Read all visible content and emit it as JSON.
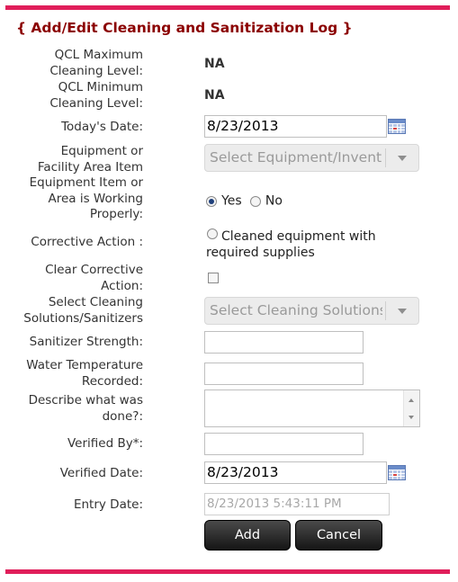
{
  "title": "{ Add/Edit Cleaning and Sanitization Log }",
  "fields": {
    "qcl_max_label": "QCL Maximum\nCleaning Level:",
    "qcl_max_value": "NA",
    "qcl_min_label": "QCL Minimum\nCleaning Level:",
    "qcl_min_value": "NA",
    "todays_date_label": "Today's Date:",
    "todays_date_value": "8/23/2013",
    "equipment_label": "Equipment or\nFacility Area Item",
    "equipment_placeholder": "Select Equipment/Inventory",
    "working_label": "Equipment Item or\nArea is Working\nProperly:",
    "working_yes": "Yes",
    "working_no": "No",
    "working_selected": "Yes",
    "corrective_label": "Corrective Action :",
    "corrective_option": "Cleaned equipment with\nrequired supplies",
    "clear_corrective_label": "Clear Corrective\nAction:",
    "clear_corrective_checked": false,
    "solutions_label": "Select Cleaning\nSolutions/Sanitizers",
    "solutions_placeholder": "Select Cleaning Solutions",
    "sanitizer_label": "Sanitizer Strength:",
    "sanitizer_value": "",
    "water_temp_label": "Water Temperature\nRecorded:",
    "water_temp_value": "",
    "describe_label": "Describe what was\ndone?:",
    "describe_value": "",
    "verified_by_label": "Verified By*:",
    "verified_by_value": "",
    "verified_date_label": "Verified Date:",
    "verified_date_value": "8/23/2013",
    "entry_date_label": "Entry Date:",
    "entry_date_value": "8/23/2013 5:43:11 PM"
  },
  "buttons": {
    "add": "Add",
    "cancel": "Cancel"
  },
  "colors": {
    "accent_bar": "#e01e5a",
    "title": "#8b0000",
    "button_bg": "#222222"
  },
  "icons": {
    "calendar": "calendar-icon",
    "dropdown": "chevron-down-icon"
  }
}
